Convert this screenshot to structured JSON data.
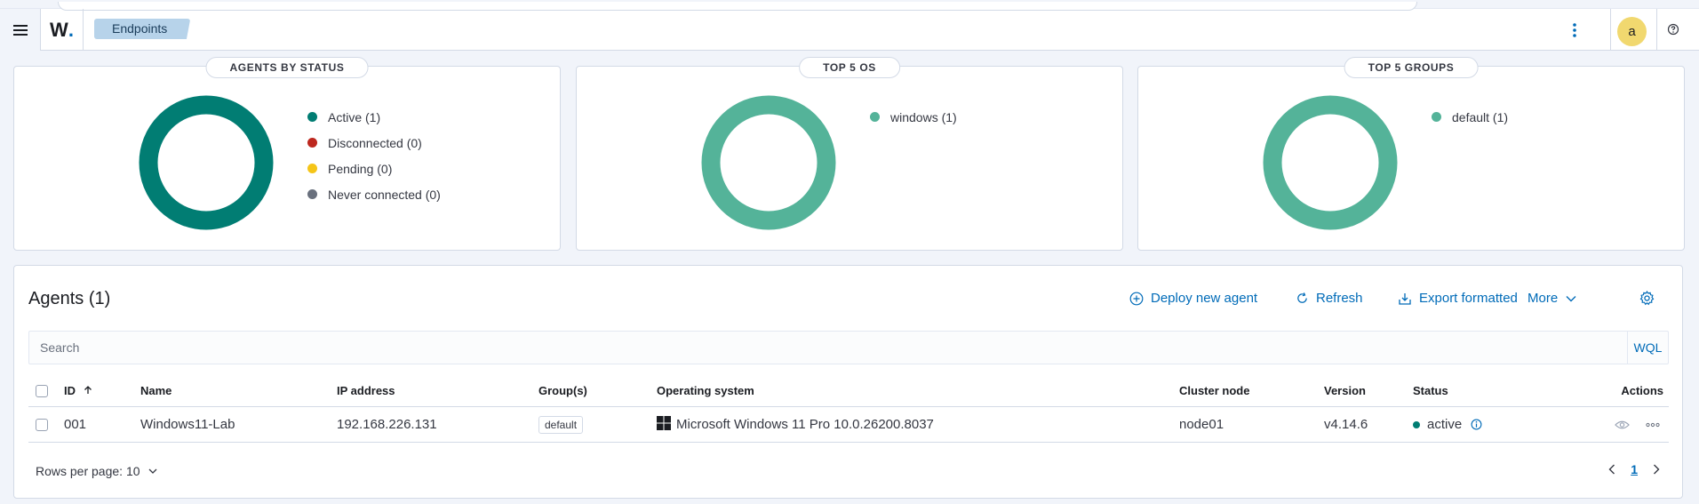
{
  "header": {
    "logo_text": "W",
    "logo_dot": ".",
    "breadcrumb": "Endpoints",
    "avatar_initial": "a"
  },
  "panels": [
    {
      "title": "AGENTS BY STATUS",
      "legend": [
        {
          "label": "Active (1)",
          "color": "#017d73"
        },
        {
          "label": "Disconnected (0)",
          "color": "#bd271e"
        },
        {
          "label": "Pending (0)",
          "color": "#f5c518"
        },
        {
          "label": "Never connected (0)",
          "color": "#69707d"
        }
      ],
      "donut_color": "#017d73"
    },
    {
      "title": "TOP 5 OS",
      "legend": [
        {
          "label": "windows (1)",
          "color": "#54b399"
        }
      ],
      "donut_color": "#54b399"
    },
    {
      "title": "TOP 5 GROUPS",
      "legend": [
        {
          "label": "default (1)",
          "color": "#54b399"
        }
      ],
      "donut_color": "#54b399"
    }
  ],
  "agents": {
    "title": "Agents (1)",
    "actions": {
      "deploy": "Deploy new agent",
      "refresh": "Refresh",
      "export": "Export formatted",
      "more": "More"
    },
    "search_placeholder": "Search",
    "wql": "WQL",
    "columns": {
      "id": "ID",
      "name": "Name",
      "ip": "IP address",
      "groups": "Group(s)",
      "os": "Operating system",
      "cluster": "Cluster node",
      "version": "Version",
      "status": "Status",
      "actions": "Actions"
    },
    "rows": [
      {
        "id": "001",
        "name": "Windows11-Lab",
        "ip": "192.168.226.131",
        "group": "default",
        "os": "Microsoft Windows 11 Pro 10.0.26200.8037",
        "cluster": "node01",
        "version": "v4.14.6",
        "status": "active"
      }
    ],
    "rows_per_page": "Rows per page: 10",
    "page": "1"
  },
  "colors": {
    "accent": "#006bb8",
    "active": "#017d73",
    "os_green": "#54b399"
  }
}
